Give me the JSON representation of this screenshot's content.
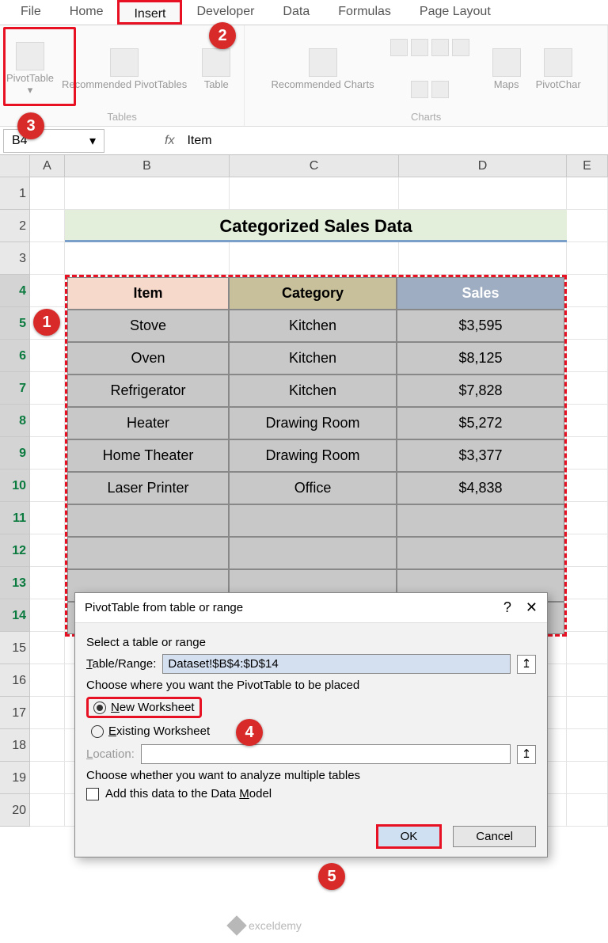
{
  "tabs": [
    "File",
    "Home",
    "Insert",
    "Developer",
    "Data",
    "Formulas",
    "Page Layout"
  ],
  "ribbon_groups": {
    "tables": {
      "label": "Tables",
      "items": [
        "PivotTable",
        "Recommended PivotTables",
        "Table"
      ]
    },
    "charts": {
      "label": "Charts",
      "items": [
        "Recommended Charts",
        "",
        "",
        "",
        "",
        "Maps",
        "PivotChar"
      ]
    }
  },
  "namebox": "B4",
  "fx": "fx",
  "formula": "Item",
  "cols": [
    "A",
    "B",
    "C",
    "D",
    "E"
  ],
  "rows": [
    "1",
    "2",
    "3",
    "4",
    "5",
    "6",
    "7",
    "8",
    "9",
    "10",
    "11",
    "12",
    "13",
    "14",
    "15",
    "16",
    "17",
    "18",
    "19",
    "20"
  ],
  "title": "Categorized Sales Data",
  "table": {
    "headers": [
      "Item",
      "Category",
      "Sales"
    ],
    "rows": [
      [
        "Stove",
        "Kitchen",
        "$3,595"
      ],
      [
        "Oven",
        "Kitchen",
        "$8,125"
      ],
      [
        "Refrigerator",
        "Kitchen",
        "$7,828"
      ],
      [
        "Heater",
        "Drawing Room",
        "$5,272"
      ],
      [
        "Home Theater",
        "Drawing Room",
        "$3,377"
      ],
      [
        "Laser Printer",
        "Office",
        "$4,838"
      ]
    ]
  },
  "dialog": {
    "title": "PivotTable from table or range",
    "select_label": "Select a table or range",
    "range_label": "Table/Range:",
    "range_value": "Dataset!$B$4:$D$14",
    "place_label": "Choose where you want the PivotTable to be placed",
    "new_ws": "New Worksheet",
    "exist_ws": "Existing Worksheet",
    "location_label": "Location:",
    "analyze_label": "Choose whether you want to analyze multiple tables",
    "datamodel": "Add this data to the Data Model",
    "ok": "OK",
    "cancel": "Cancel",
    "help": "?",
    "close": "✕"
  },
  "badges": {
    "b1": "1",
    "b2": "2",
    "b3": "3",
    "b4": "4",
    "b5": "5"
  },
  "watermark": "exceldemy"
}
